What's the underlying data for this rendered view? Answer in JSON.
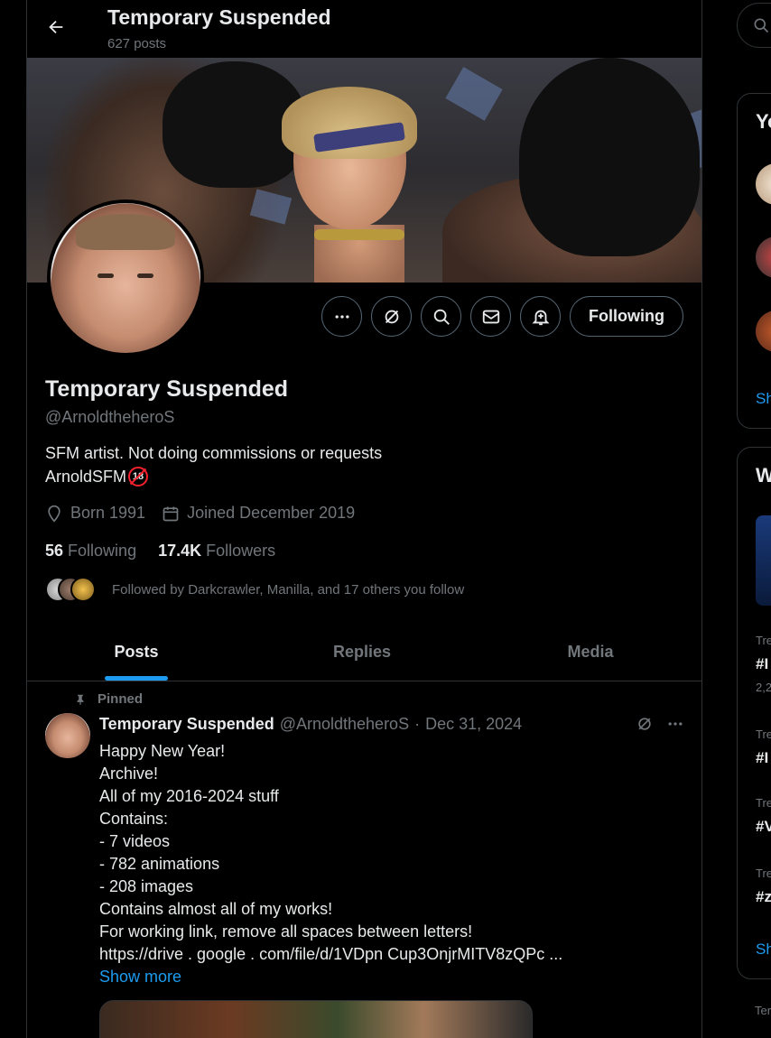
{
  "header": {
    "title": "Temporary Suspended",
    "post_count": "627 posts"
  },
  "profile": {
    "name": "Temporary Suspended",
    "handle": "@ArnoldtheheroS",
    "bio_line1": "SFM artist. Not doing commissions or requests",
    "bio_line2": "ArnoldSFM",
    "bio_badge": "18",
    "born": "Born 1991",
    "joined": "Joined December 2019",
    "following_count": "56",
    "following_label": "Following",
    "followers_count": "17.4K",
    "followers_label": "Followers",
    "followed_by": "Followed by Darkcrawler, Manilla, and 17 others you follow",
    "follow_button": "Following"
  },
  "tabs": [
    {
      "label": "Posts",
      "active": true
    },
    {
      "label": "Replies",
      "active": false
    },
    {
      "label": "Media",
      "active": false
    }
  ],
  "pinned_post": {
    "pinned_label": "Pinned",
    "author_name": "Temporary Suspended",
    "author_handle": "@ArnoldtheheroS",
    "separator": "·",
    "date": "Dec 31, 2024",
    "lines": [
      "Happy New Year!",
      "Archive!",
      "All of my 2016-2024 stuff",
      "Contains:",
      "- 7 videos",
      "- 782 animations",
      "- 208 images",
      "Contains almost all of my works!",
      "For working link, remove all spaces between letters!",
      "https://drive . google . com/file/d/1VDpn Cup3OnjrMITV8zQPc ..."
    ],
    "show_more": "Show more"
  },
  "right_column": {
    "panel1_title_fragment": "Yo",
    "panel1_link_fragment": "Sh",
    "panel2_title_fragment": "W",
    "trend_label_fragment": "Tre",
    "trend_items": [
      "#I",
      "#I",
      "#V",
      "#z"
    ],
    "trend_count_fragment": "2,2",
    "panel2_link_fragment": "Sh",
    "footer_fragment": "Ter"
  },
  "colors": {
    "accent": "#1d9bf0",
    "background": "#000000",
    "text_primary": "#e7e9ea",
    "text_secondary": "#71767b",
    "border": "#2f3336",
    "nsfw_badge": "#f4212e"
  },
  "icons": {
    "back": "arrow-left-icon",
    "more": "more-horizontal-icon",
    "grok": "grok-icon",
    "search": "search-icon",
    "message": "mail-icon",
    "notify": "bell-plus-icon",
    "location": "location-pin-icon",
    "calendar": "calendar-icon",
    "pin": "pin-icon"
  }
}
